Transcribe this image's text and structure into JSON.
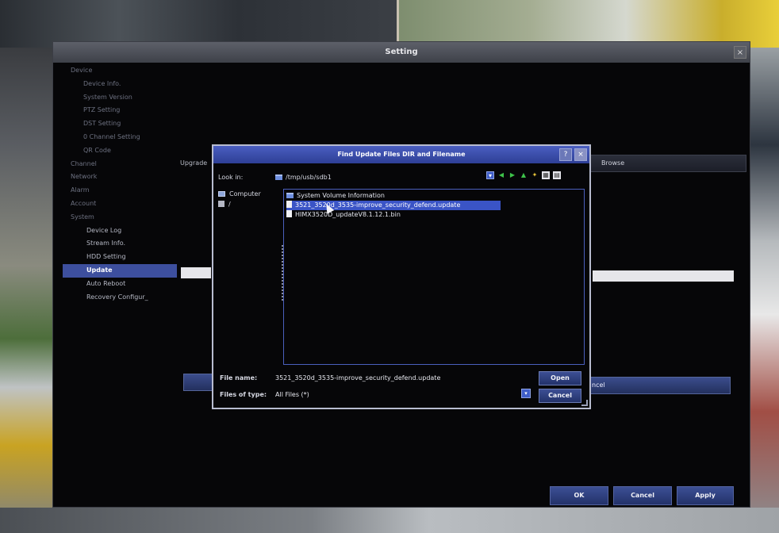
{
  "window": {
    "title": "Setting",
    "close_label": "×"
  },
  "sidebar": {
    "items": [
      {
        "label": "Device",
        "level": 0
      },
      {
        "label": "Device Info.",
        "level": 1
      },
      {
        "label": "System Version",
        "level": 1
      },
      {
        "label": "PTZ Setting",
        "level": 1
      },
      {
        "label": "DST Setting",
        "level": 1
      },
      {
        "label": "0 Channel Setting",
        "level": 1
      },
      {
        "label": "QR Code",
        "level": 1
      },
      {
        "label": "Channel",
        "level": 0
      },
      {
        "label": "Network",
        "level": 0
      },
      {
        "label": "Alarm",
        "level": 0
      },
      {
        "label": "Account",
        "level": 0
      },
      {
        "label": "System",
        "level": 0
      },
      {
        "label": "Device Log",
        "level": 2
      },
      {
        "label": "Stream Info.",
        "level": 2
      },
      {
        "label": "HDD Setting",
        "level": 2
      },
      {
        "label": "Update",
        "level": 2,
        "active": true
      },
      {
        "label": "Auto Reboot",
        "level": 2
      },
      {
        "label": "Recovery Configur_",
        "level": 2
      }
    ]
  },
  "content": {
    "upgrade_label": "Upgrade",
    "browse_label": "Browse",
    "cancel_partial": "ncel"
  },
  "footer": {
    "ok": "OK",
    "cancel": "Cancel",
    "apply": "Apply"
  },
  "dialog": {
    "title": "Find Update Files DIR and Filename",
    "help_label": "?",
    "close_label": "×",
    "look_in_label": "Look in:",
    "look_in_path": "/tmp/usb/sdb1",
    "places": [
      {
        "label": "Computer",
        "icon": "computer-icon"
      },
      {
        "label": "/",
        "icon": "disk-icon"
      }
    ],
    "files": [
      {
        "label": "System Volume Information",
        "type": "folder"
      },
      {
        "label": "3521_3520d_3535-improve_security_defend.update",
        "type": "file",
        "selected": true
      },
      {
        "label": "HIMX3520D_updateV8.1.12.1.bin",
        "type": "file"
      }
    ],
    "file_name_label": "File name:",
    "file_name_value": "3521_3520d_3535-improve_security_defend.update",
    "files_of_type_label": "Files of type:",
    "files_of_type_value": "All Files (*)",
    "open": "Open",
    "cancel": "Cancel"
  },
  "colors": {
    "accent": "#3d4f9e",
    "selection": "#3a54c6",
    "dialog_title": "#2e3f96"
  }
}
